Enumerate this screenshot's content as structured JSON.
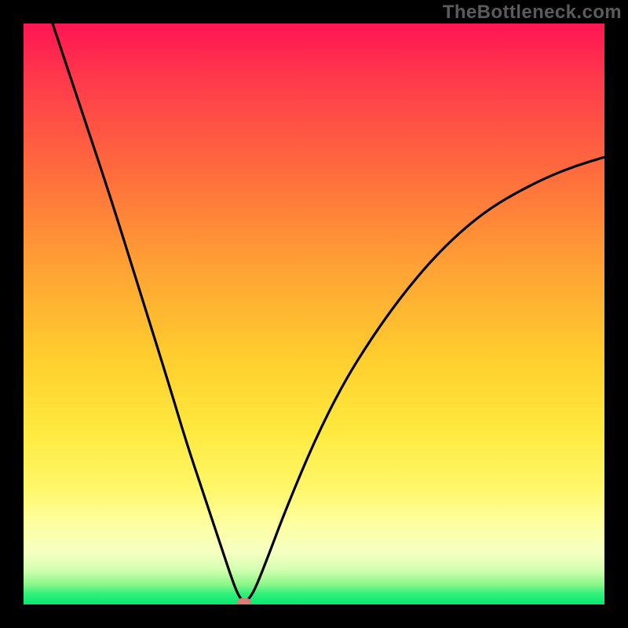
{
  "watermark": "TheBottleneck.com",
  "chart_data": {
    "type": "line",
    "title": "",
    "xlabel": "",
    "ylabel": "",
    "xlim": [
      0,
      100
    ],
    "ylim": [
      0,
      100
    ],
    "grid": false,
    "note": "Gradient background runs from red (top, high bottleneck) to green (bottom, low bottleneck). The black curve descends from top-left, reaches ~0 near x≈38 (the marker), then rises toward the right, approaching ~77 at the right edge. Values are read from relative pixel positions since no axis ticks are shown.",
    "series": [
      {
        "name": "bottleneck-curve",
        "x": [
          5,
          10,
          15,
          20,
          25,
          28,
          31,
          34,
          36,
          37,
          38,
          39,
          40,
          42,
          45,
          50,
          55,
          60,
          65,
          70,
          75,
          80,
          85,
          90,
          95,
          100
        ],
        "y": [
          100,
          85,
          70,
          54,
          38,
          28,
          19,
          10,
          4,
          1.5,
          0.3,
          1.2,
          3,
          8,
          16,
          28,
          38,
          46,
          53,
          59,
          64,
          68,
          71,
          73.5,
          75.5,
          77
        ]
      }
    ],
    "marker": {
      "x": 38,
      "y": 0.3
    },
    "background_gradient_stops": [
      {
        "pct": 0,
        "color": "#ff1552"
      },
      {
        "pct": 42,
        "color": "#ffa234"
      },
      {
        "pct": 80,
        "color": "#fff76a"
      },
      {
        "pct": 100,
        "color": "#07e96f"
      }
    ]
  }
}
